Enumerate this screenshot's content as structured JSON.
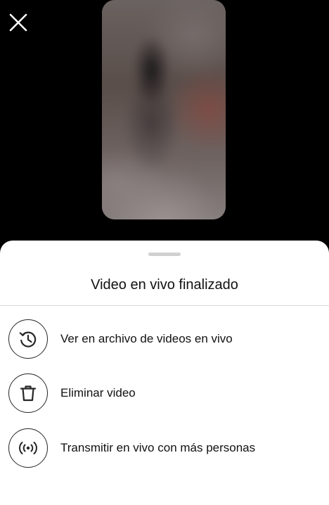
{
  "header": {
    "close_icon": "close-icon"
  },
  "sheet": {
    "title": "Video en vivo finalizado",
    "options": [
      {
        "label": "Ver en archivo de videos en vivo",
        "icon": "archive-history-icon"
      },
      {
        "label": "Eliminar video",
        "icon": "trash-icon"
      },
      {
        "label": "Transmitir en vivo con más personas",
        "icon": "live-broadcast-icon"
      }
    ]
  },
  "colors": {
    "background": "#000000",
    "sheet": "#ffffff",
    "text": "#111111",
    "divider": "#dbdbdb",
    "grabber": "#d0d0d0"
  }
}
